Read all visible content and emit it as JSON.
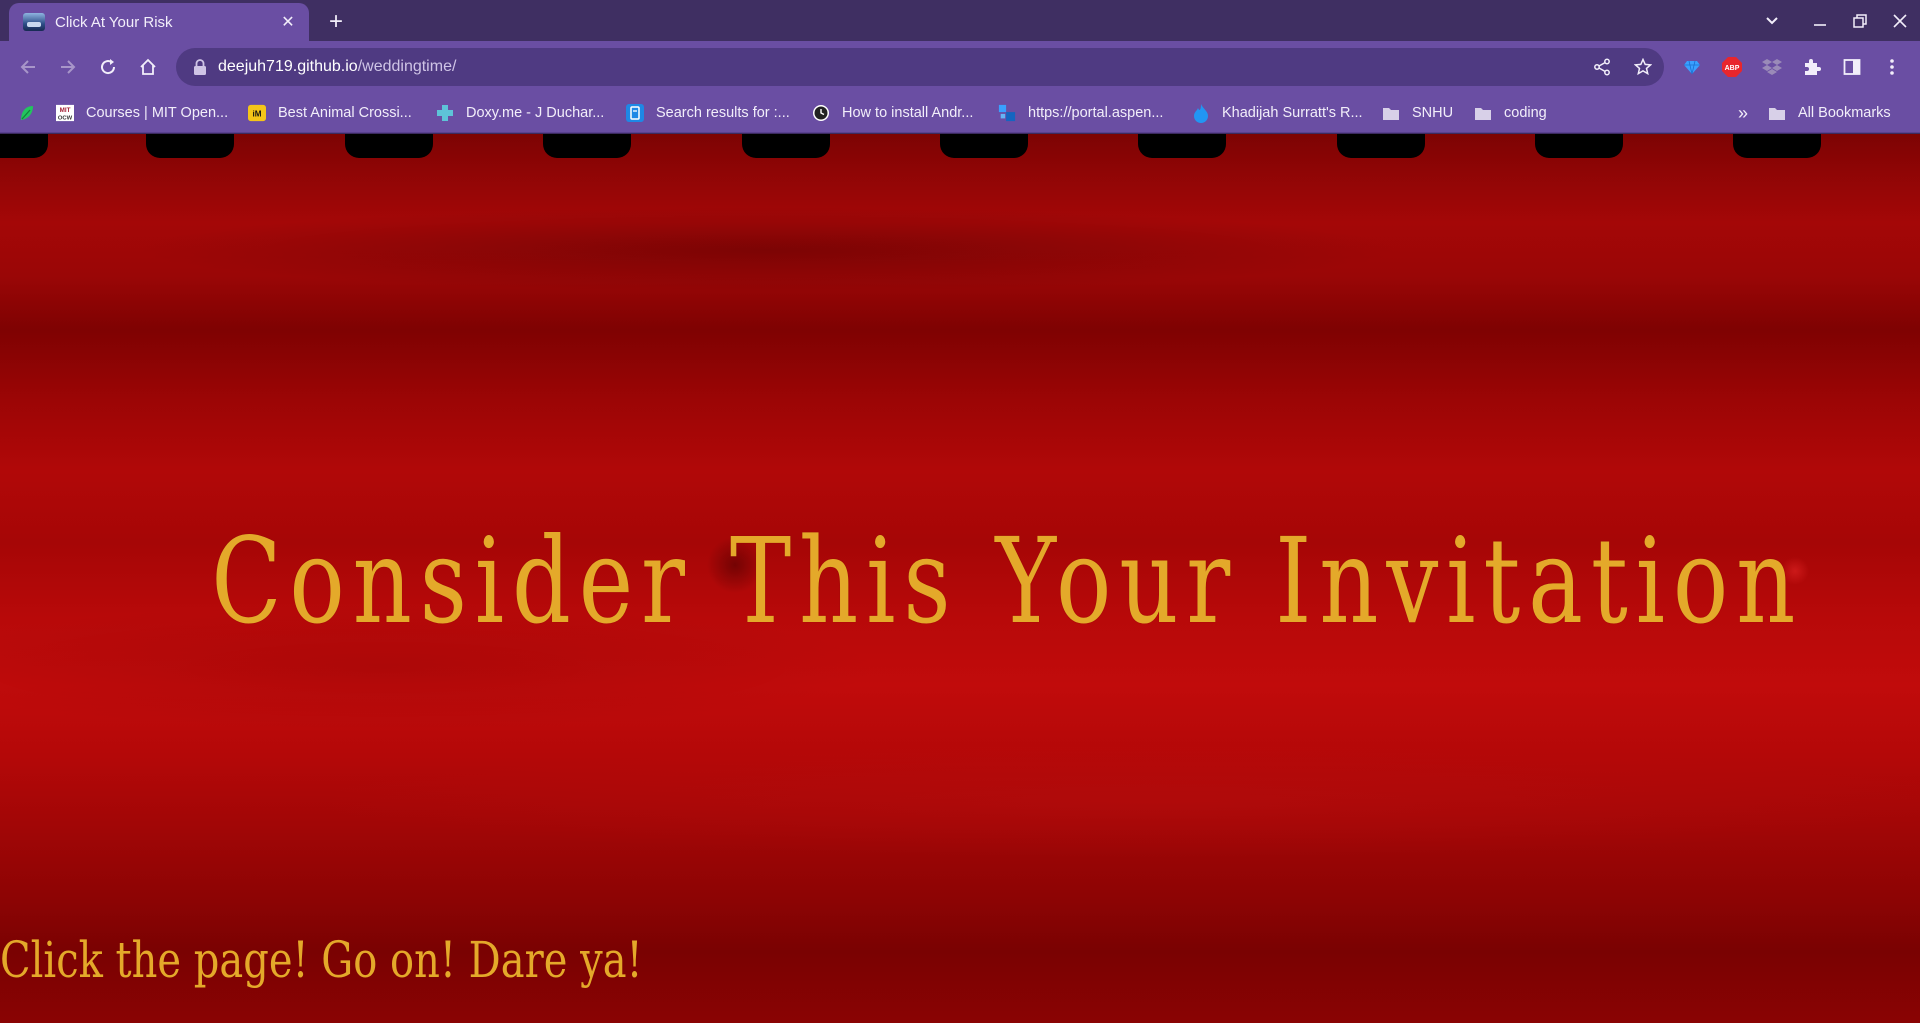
{
  "browser": {
    "tab": {
      "title": "Click At Your Risk",
      "close_label": "✕"
    },
    "new_tab_label": "+",
    "address": {
      "host": "deejuh719.github.io",
      "path": "/weddingtime/"
    },
    "bookmarks": [
      {
        "label": "Courses | MIT Open...",
        "icon": "mit-ocw-icon"
      },
      {
        "label": "Best Animal Crossi...",
        "icon": "im-icon"
      },
      {
        "label": "Doxy.me - J Duchar...",
        "icon": "doxy-cross-icon"
      },
      {
        "label": "Search results for :...",
        "icon": "search-app-icon"
      },
      {
        "label": "How to install Andr...",
        "icon": "clock-icon"
      },
      {
        "label": "https://portal.aspen...",
        "icon": "aspen-icon"
      },
      {
        "label": "Khadijah Surratt's R...",
        "icon": "flame-icon"
      },
      {
        "label": "SNHU",
        "icon": "folder-icon"
      },
      {
        "label": "coding",
        "icon": "folder-icon"
      }
    ],
    "overflow_label": "»",
    "all_bookmarks_label": "All Bookmarks"
  },
  "page": {
    "headline": "Consider This Your Invitation",
    "cta": "Click the page! Go on! Dare ya!"
  },
  "colors": {
    "chrome_tabstrip": "#3f2f62",
    "chrome_toolbar": "#6a4ea3",
    "page_red": "#a80707",
    "text_gold": "#e4a92a"
  }
}
